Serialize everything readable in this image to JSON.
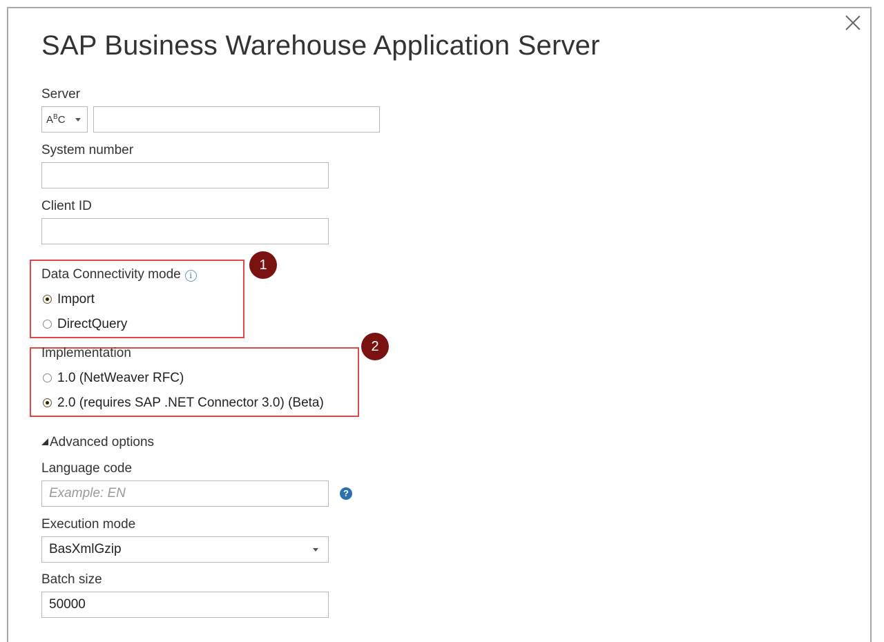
{
  "dialog": {
    "title": "SAP Business Warehouse Application Server"
  },
  "fields": {
    "server_label": "Server",
    "server_value": "",
    "server_type_icon": "abc-text-type-icon",
    "system_number_label": "System number",
    "system_number_value": "",
    "client_id_label": "Client ID",
    "client_id_value": ""
  },
  "connectivity": {
    "label": "Data Connectivity mode",
    "info_icon": "info-icon",
    "options": [
      {
        "label": "Import",
        "selected": true
      },
      {
        "label": "DirectQuery",
        "selected": false
      }
    ],
    "badge": "1"
  },
  "implementation": {
    "label": "Implementation",
    "options": [
      {
        "label": "1.0 (NetWeaver RFC)",
        "selected": false
      },
      {
        "label": "2.0 (requires SAP .NET Connector 3.0) (Beta)",
        "selected": true
      }
    ],
    "badge": "2"
  },
  "advanced": {
    "toggle_label": "Advanced options",
    "language_code_label": "Language code",
    "language_code_placeholder": "Example: EN",
    "help_icon": "question-icon",
    "execution_mode_label": "Execution mode",
    "execution_mode_value": "BasXmlGzip",
    "batch_size_label": "Batch size",
    "batch_size_value": "50000"
  },
  "colors": {
    "highlight_box": "#e04848",
    "badge": "#7b1212",
    "help_icon": "#2e6fb0"
  }
}
